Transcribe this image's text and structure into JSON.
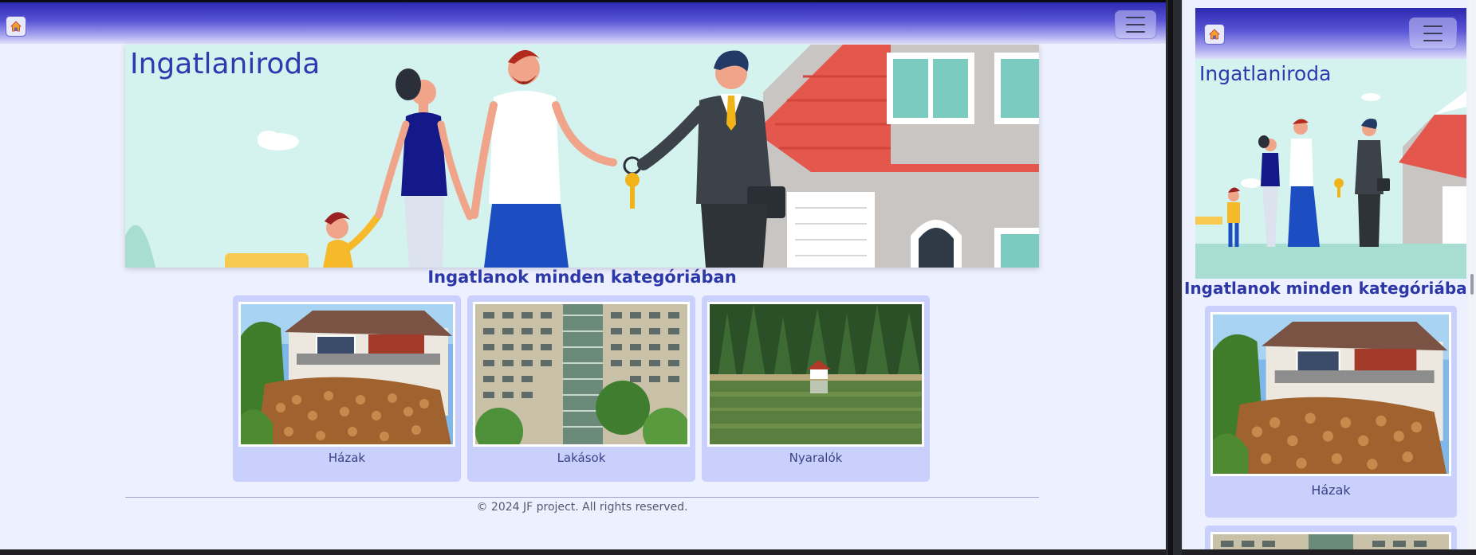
{
  "navbar": {
    "home_icon": "house-icon",
    "menu_icon": "hamburger-menu-icon"
  },
  "hero": {
    "title": "Ingatlaniroda",
    "image": "family-receives-house-keys-illustration"
  },
  "section": {
    "title": "Ingatlanok minden kategóriában"
  },
  "categories": [
    {
      "label": "Házak",
      "image": "house-with-firewood-photo"
    },
    {
      "label": "Lakások",
      "image": "apartment-block-photo"
    },
    {
      "label": "Nyaralók",
      "image": "lake-cabin-forest-photo"
    }
  ],
  "footer": {
    "text": "© 2024 JF project. All rights reserved."
  },
  "colors": {
    "accent": "#2e3bb0",
    "page_background": "#edf0fe",
    "card_background": "#c8d0fb",
    "navbar_gradient_top": "#2c28b0"
  }
}
